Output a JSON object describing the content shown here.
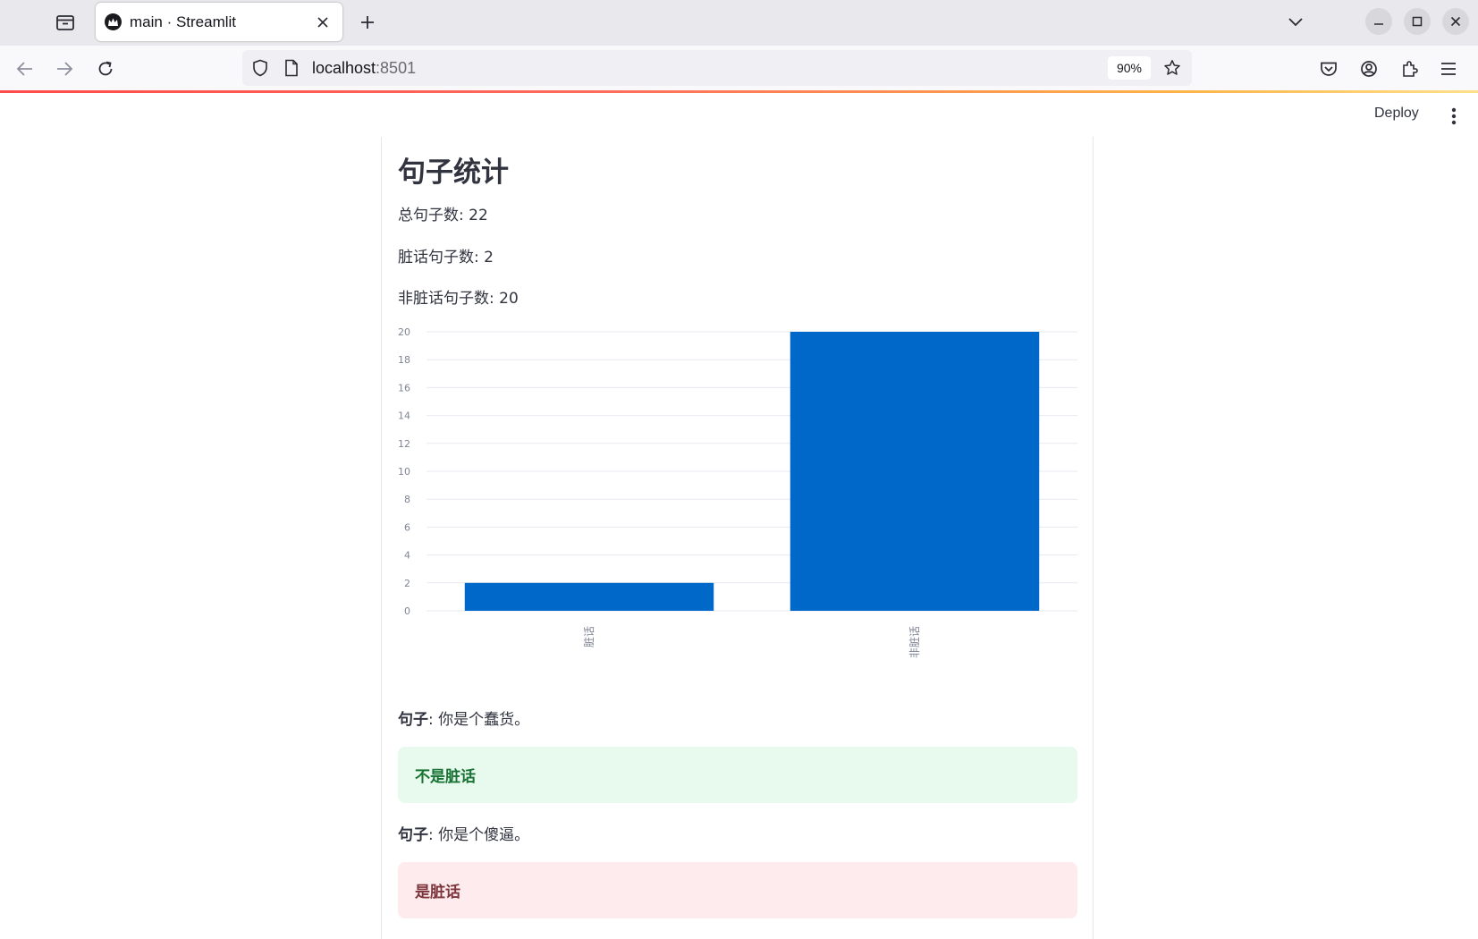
{
  "browser": {
    "tab_title": "main · Streamlit",
    "url_host": "localhost",
    "url_port": ":8501",
    "zoom": "90%",
    "icons": [
      "tab-list-icon",
      "streamlit-favicon-icon",
      "close-icon",
      "plus-icon",
      "chevron-down-icon",
      "minimize-icon",
      "maximize-icon",
      "window-close-icon",
      "back-arrow-icon",
      "forward-arrow-icon",
      "reload-icon",
      "shield-icon",
      "page-icon",
      "star-icon",
      "pocket-icon",
      "account-icon",
      "extensions-icon",
      "hamburger-menu-icon"
    ]
  },
  "app": {
    "deploy_label": "Deploy",
    "title": "句子统计",
    "stats": {
      "total": "总句子数: 22",
      "dirty": "脏话句子数: 2",
      "clean": "非脏话句子数: 20"
    },
    "sentences": [
      {
        "label": "句子",
        "sep": ": ",
        "text": "你是个蠢货。",
        "result": "不是脏话",
        "kind": "success"
      },
      {
        "label": "句子",
        "sep": ": ",
        "text": "你是个傻逼。",
        "result": "是脏话",
        "kind": "error"
      }
    ]
  },
  "chart_data": {
    "type": "bar",
    "categories": [
      "脏话",
      "非脏话"
    ],
    "values": [
      2,
      20
    ],
    "ylim": [
      0,
      20
    ],
    "yticks": [
      0,
      2,
      4,
      6,
      8,
      10,
      12,
      14,
      16,
      18,
      20
    ],
    "grid": true,
    "bar_color": "#0068c9",
    "title": "",
    "xlabel": "",
    "ylabel": ""
  },
  "colors": {
    "success_bg": "#e8f9ee",
    "success_text": "#177233",
    "error_bg": "#fdebed",
    "error_text": "#7d353b",
    "bar": "#0068c9"
  }
}
